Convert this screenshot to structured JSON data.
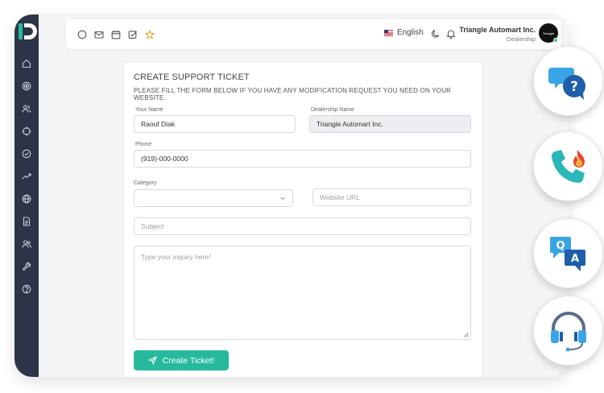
{
  "header": {
    "icons": [
      "circle-icon",
      "mail-icon",
      "calendar-icon",
      "checkbox-icon",
      "star-icon"
    ],
    "language": "English",
    "dealer_name": "Triangle Automart Inc.",
    "dealer_role": "Dealership",
    "avatar_text": "Triangle"
  },
  "sidebar": {
    "items": [
      "home-icon",
      "target-icon",
      "users-icon",
      "crosshair-icon",
      "check-circle-icon",
      "trend-icon",
      "globe-icon",
      "document-icon",
      "team-icon",
      "wrench-icon",
      "help-icon"
    ]
  },
  "form": {
    "title": "CREATE SUPPORT TICKET",
    "subtitle": "PLEASE FILL THE FORM BELOW IF YOU HAVE ANY MODIFICATION REQUEST YOU NEED ON YOUR WEBSITE.",
    "your_name_label": "Your Name",
    "your_name_value": "Raouf Diak",
    "dealership_label": "Dealership Name",
    "dealership_value": "Triangle Automart Inc.",
    "phone_label": "Phone",
    "phone_value": "(919)-000-0000",
    "category_label": "Category",
    "category_value": "",
    "website_placeholder": "Website URL",
    "subject_placeholder": "Subject",
    "inquiry_placeholder": "Type your inquiry here!",
    "submit_label": "Create Ticket!"
  },
  "quick_actions": [
    "support-chat-icon",
    "hot-phone-icon",
    "qa-icon",
    "headset-icon"
  ],
  "colors": {
    "sidebar": "#2b3547",
    "accent": "#27b99d",
    "star": "#f0a020"
  }
}
